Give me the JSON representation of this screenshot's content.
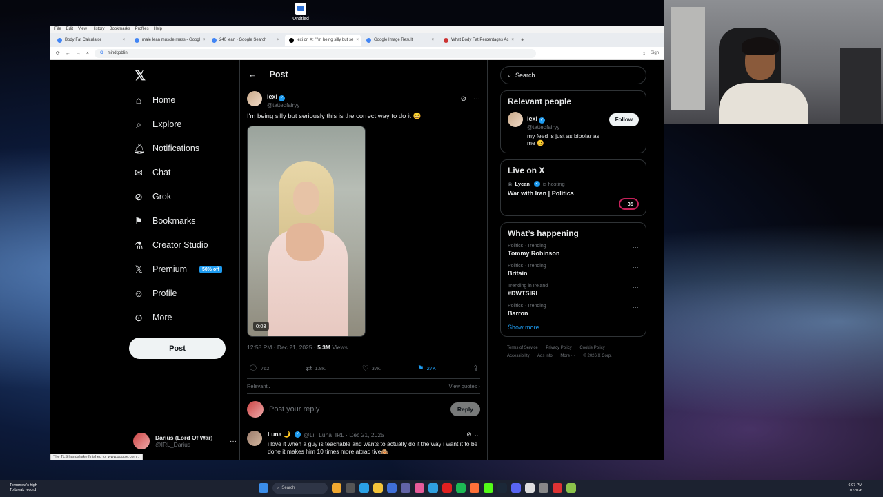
{
  "desktop": {
    "icon_label": "Untitled"
  },
  "browser": {
    "menu": [
      "File",
      "Edit",
      "View",
      "History",
      "Bookmarks",
      "Profiles",
      "Help"
    ],
    "tabs": [
      {
        "label": "Body Fat Calculator",
        "active": false
      },
      {
        "label": "male lean muscle mass - Googl",
        "active": false
      },
      {
        "label": "240 lean - Google Search",
        "active": false
      },
      {
        "label": "lexi on X: \"I'm being silly but se",
        "active": true
      },
      {
        "label": "Google Image Result",
        "active": false
      },
      {
        "label": "What Body Fat Percentages Ac",
        "active": false
      }
    ],
    "new_tab": "+",
    "address": "mindgoblin",
    "sign_in": "Sign"
  },
  "x": {
    "nav": [
      {
        "label": "Home",
        "icon": "home-icon",
        "glyph": "⌂"
      },
      {
        "label": "Explore",
        "icon": "search-icon",
        "glyph": "⌕"
      },
      {
        "label": "Notifications",
        "icon": "bell-icon",
        "glyph": "🔔︎"
      },
      {
        "label": "Chat",
        "icon": "envelope-icon",
        "glyph": "✉"
      },
      {
        "label": "Grok",
        "icon": "grok-icon",
        "glyph": "⊘"
      },
      {
        "label": "Bookmarks",
        "icon": "bookmark-icon",
        "glyph": "⚑"
      },
      {
        "label": "Creator Studio",
        "icon": "flask-icon",
        "glyph": "⚗"
      },
      {
        "label": "Premium",
        "icon": "x-icon",
        "glyph": "𝕏",
        "badge": "50% off"
      },
      {
        "label": "Profile",
        "icon": "person-icon",
        "glyph": "☺"
      },
      {
        "label": "More",
        "icon": "more-circle-icon",
        "glyph": "⊙"
      }
    ],
    "post_button": "Post",
    "me": {
      "name": "Darius (Lord Of War)",
      "handle": "@IRL_Darius"
    },
    "header": {
      "title": "Post"
    },
    "post": {
      "author": "lexi",
      "handle": "@tattedfairyy",
      "text": "I'm being silly but seriously this is the correct way to do it 😆",
      "duration": "0:03",
      "time": "12:58 PM · Dec 21, 2025 · ",
      "views": "5.3M",
      "views_label": " Views",
      "replies": "762",
      "reposts": "1.8K",
      "likes": "37K",
      "bookmarks": "27K",
      "relevant": "Relevant",
      "view_quotes": "View quotes"
    },
    "reply_placeholder": "Post your reply",
    "reply_button": "Reply",
    "comment": {
      "author": "Luna 🌙",
      "handle": "@Lil_Luna_IRL · Dec 21, 2025",
      "text": "i love it when a guy is teachable and wants to actually do it the way i want it to be done it makes him 10 times more attrac tive🙈"
    },
    "search_placeholder": "Search",
    "relevant_people": {
      "title": "Relevant people",
      "name": "lexi",
      "handle": "@tattedfairyy",
      "bio": "my feed is just as bipolar as me 🥴",
      "follow": "Follow"
    },
    "live": {
      "title": "Live on X",
      "host": "Lycan",
      "hosting": "is hosting",
      "show": "War with Iran | Politics",
      "count": "+35"
    },
    "happening": {
      "title": "What’s happening",
      "trends": [
        {
          "meta": "Politics · Trending",
          "title": "Tommy Robinson"
        },
        {
          "meta": "Politics · Trending",
          "title": "Britain"
        },
        {
          "meta": "Trending in Ireland",
          "title": "#DWTSIRL"
        },
        {
          "meta": "Politics · Trending",
          "title": "Barron"
        }
      ],
      "show_more": "Show more"
    },
    "footer": [
      "Terms of Service",
      "Privacy Policy",
      "Cookie Policy",
      "Accessibility",
      "Ads info",
      "More ···",
      "© 2026 X Corp."
    ]
  },
  "statusline": "The TLS handshake finished for www.google.com...",
  "taskbar": {
    "weather_title": "Tomorrow's high",
    "weather_sub": "To break record",
    "search": "Search",
    "time": "6:07 PM",
    "date": "1/1/2026"
  },
  "colors": {
    "accent": "#1d9bf0",
    "live_ring": "#c6215a"
  }
}
